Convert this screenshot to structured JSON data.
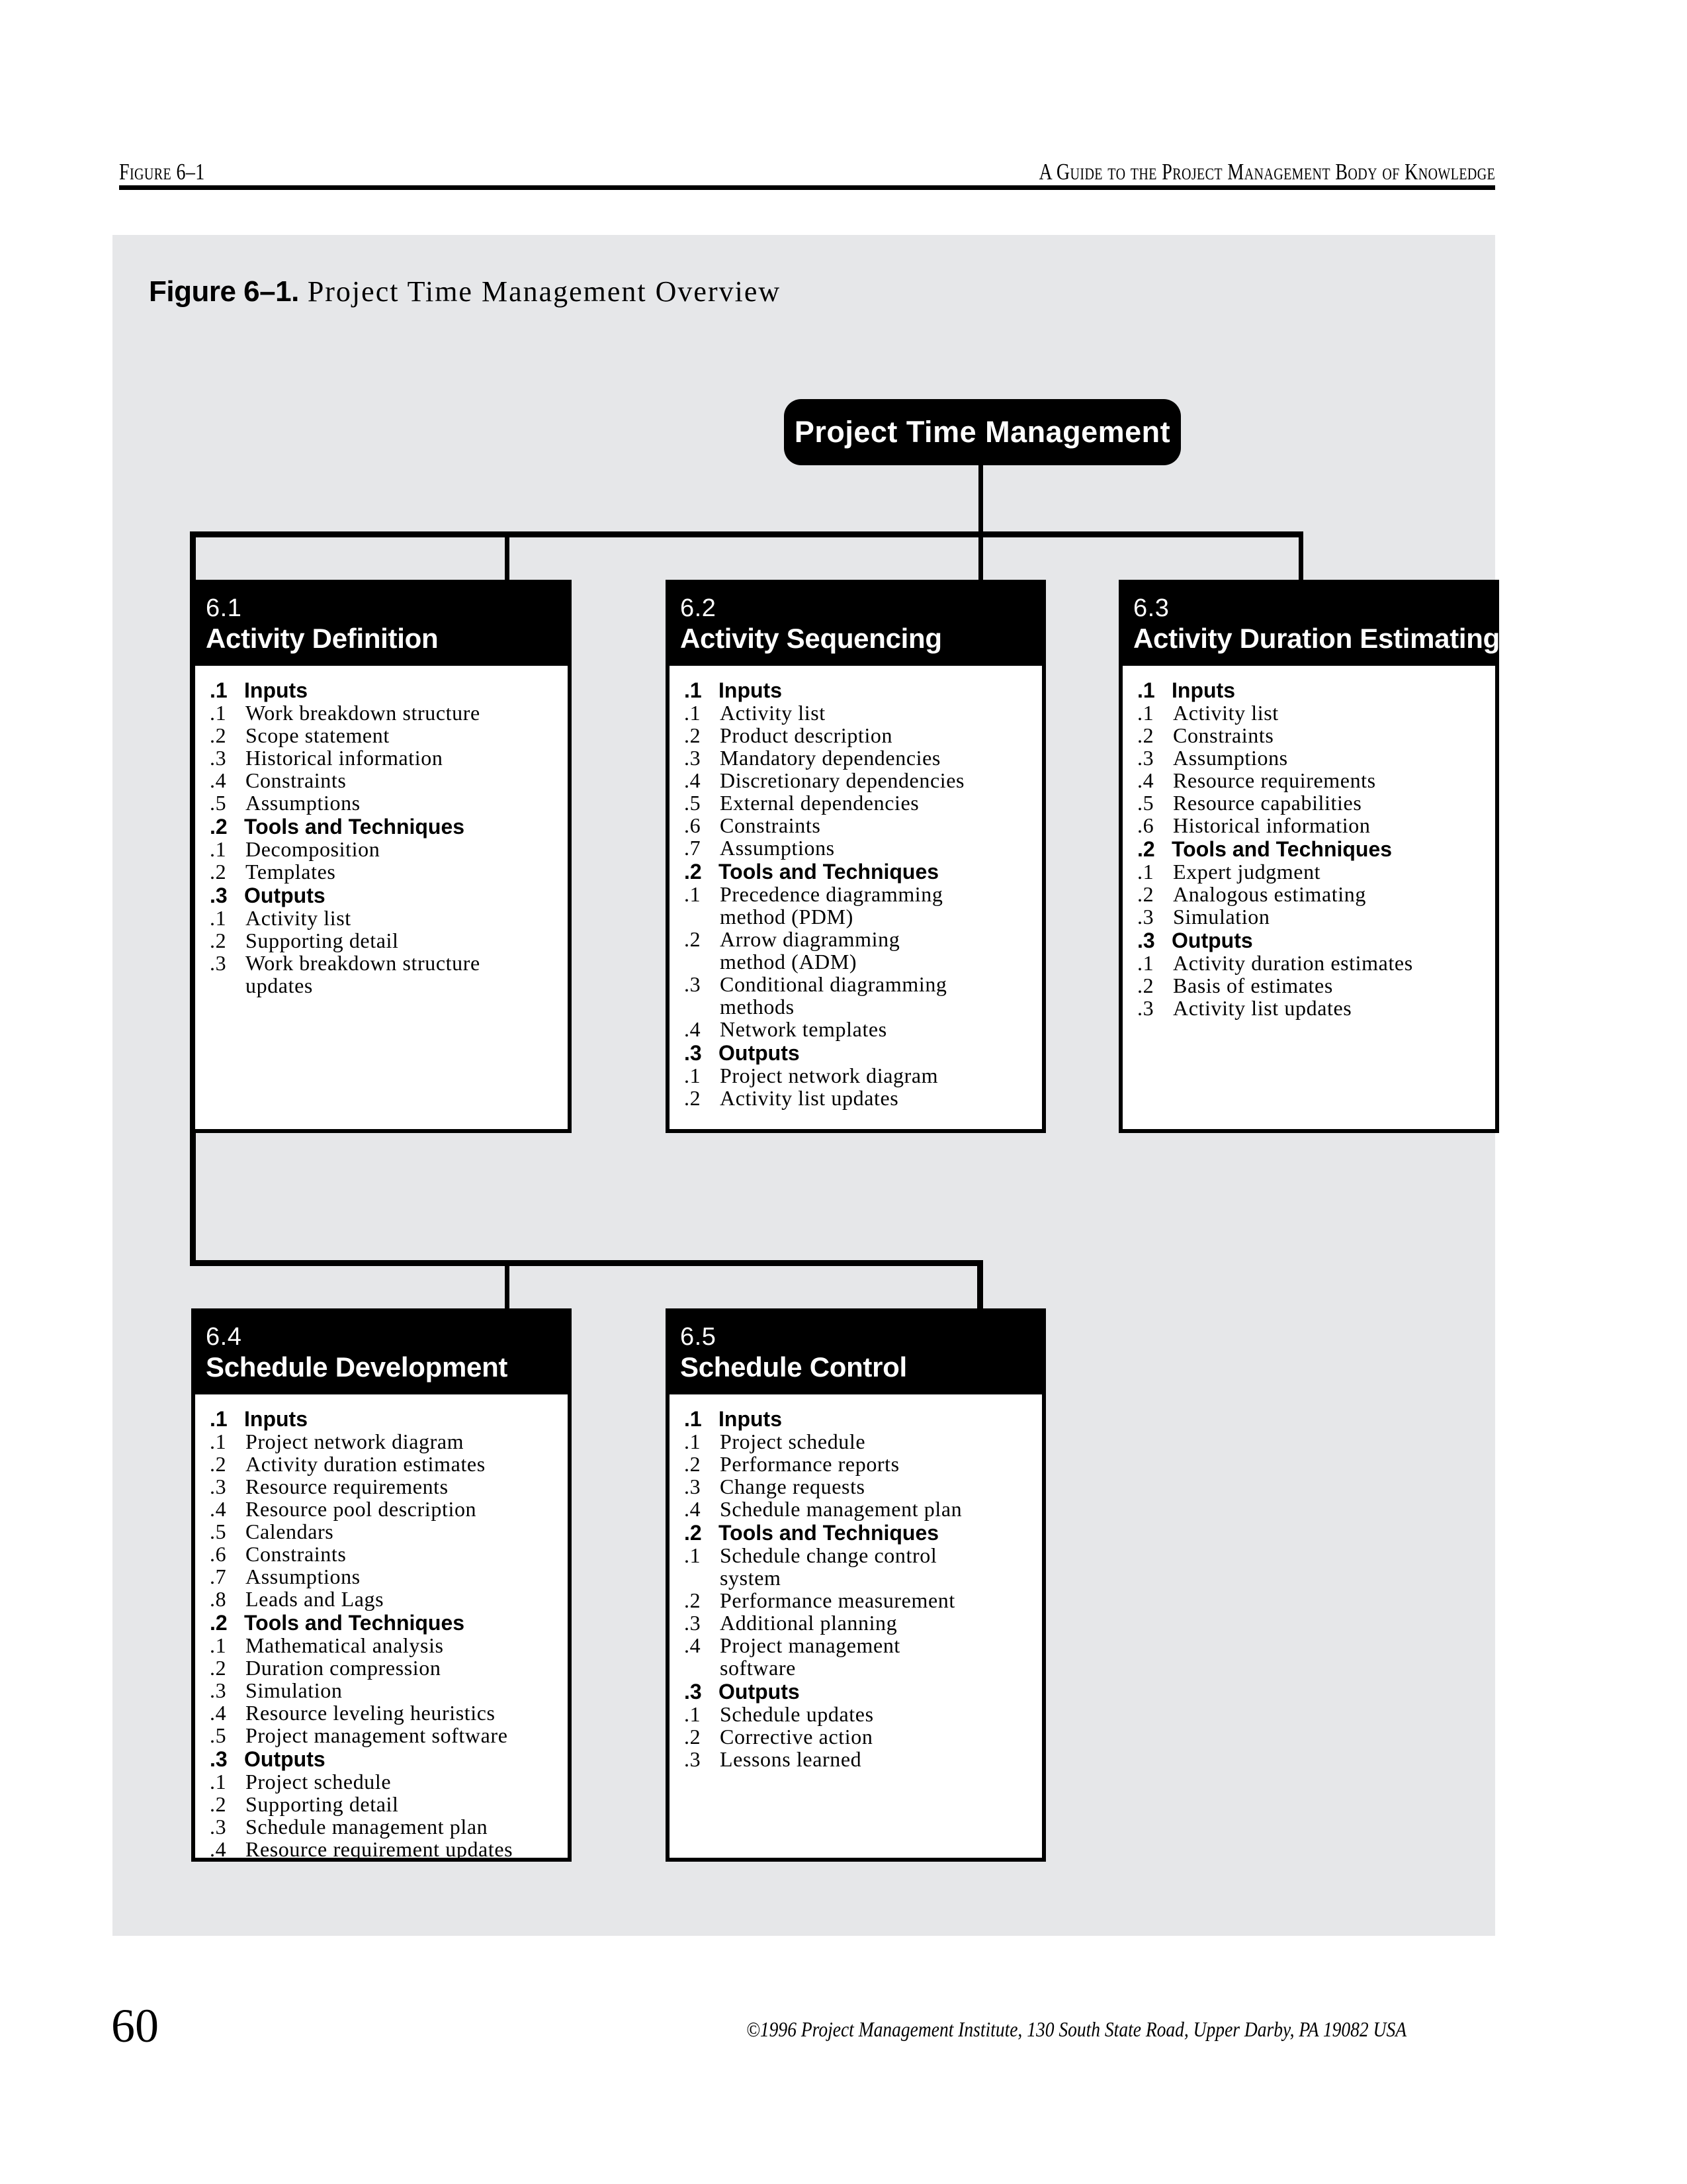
{
  "header": {
    "left": "Figure 6–1",
    "right": "A Guide to the Project Management Body of Knowledge"
  },
  "figure": {
    "caption_bold": "Figure 6–1.",
    "caption_rest": " Project Time Management Overview",
    "root_node": "Project Time Management",
    "panel_color": "#e6e7e9",
    "node_color": "#000000",
    "node_text_color": "#ffffff"
  },
  "diagram_data": {
    "type": "hierarchy",
    "root": "Project Time Management",
    "children": [
      {
        "number": "6.1",
        "title": "Activity Definition",
        "sections": [
          {
            "number": ".1",
            "label": "Inputs",
            "items": [
              {
                "num": ".1",
                "lines": [
                  "Work breakdown structure"
                ]
              },
              {
                "num": ".2",
                "lines": [
                  "Scope statement"
                ]
              },
              {
                "num": ".3",
                "lines": [
                  "Historical information"
                ]
              },
              {
                "num": ".4",
                "lines": [
                  "Constraints"
                ]
              },
              {
                "num": ".5",
                "lines": [
                  "Assumptions"
                ]
              }
            ]
          },
          {
            "number": ".2",
            "label": "Tools and Techniques",
            "items": [
              {
                "num": ".1",
                "lines": [
                  "Decomposition"
                ]
              },
              {
                "num": ".2",
                "lines": [
                  "Templates"
                ]
              }
            ]
          },
          {
            "number": ".3",
            "label": "Outputs",
            "items": [
              {
                "num": ".1",
                "lines": [
                  "Activity list"
                ]
              },
              {
                "num": ".2",
                "lines": [
                  "Supporting detail"
                ]
              },
              {
                "num": ".3",
                "lines": [
                  "Work breakdown structure",
                  "updates"
                ]
              }
            ]
          }
        ]
      },
      {
        "number": "6.2",
        "title": "Activity Sequencing",
        "sections": [
          {
            "number": ".1",
            "label": "Inputs",
            "items": [
              {
                "num": ".1",
                "lines": [
                  "Activity list"
                ]
              },
              {
                "num": ".2",
                "lines": [
                  "Product description"
                ]
              },
              {
                "num": ".3",
                "lines": [
                  "Mandatory dependencies"
                ]
              },
              {
                "num": ".4",
                "lines": [
                  "Discretionary dependencies"
                ]
              },
              {
                "num": ".5",
                "lines": [
                  "External dependencies"
                ]
              },
              {
                "num": ".6",
                "lines": [
                  "Constraints"
                ]
              },
              {
                "num": ".7",
                "lines": [
                  "Assumptions"
                ]
              }
            ]
          },
          {
            "number": ".2",
            "label": "Tools and Techniques",
            "items": [
              {
                "num": ".1",
                "lines": [
                  "Precedence diagramming",
                  "method (PDM)"
                ]
              },
              {
                "num": ".2",
                "lines": [
                  "Arrow diagramming",
                  "method (ADM)"
                ]
              },
              {
                "num": ".3",
                "lines": [
                  "Conditional diagramming",
                  "methods"
                ]
              },
              {
                "num": ".4",
                "lines": [
                  "Network templates"
                ]
              }
            ]
          },
          {
            "number": ".3",
            "label": "Outputs",
            "items": [
              {
                "num": ".1",
                "lines": [
                  "Project network diagram"
                ]
              },
              {
                "num": ".2",
                "lines": [
                  "Activity list updates"
                ]
              }
            ]
          }
        ]
      },
      {
        "number": "6.3",
        "title": "Activity Duration Estimating",
        "sections": [
          {
            "number": ".1",
            "label": "Inputs",
            "items": [
              {
                "num": ".1",
                "lines": [
                  "Activity list"
                ]
              },
              {
                "num": ".2",
                "lines": [
                  "Constraints"
                ]
              },
              {
                "num": ".3",
                "lines": [
                  "Assumptions"
                ]
              },
              {
                "num": ".4",
                "lines": [
                  "Resource requirements"
                ]
              },
              {
                "num": ".5",
                "lines": [
                  "Resource capabilities"
                ]
              },
              {
                "num": ".6",
                "lines": [
                  "Historical information"
                ]
              }
            ]
          },
          {
            "number": ".2",
            "label": "Tools and Techniques",
            "items": [
              {
                "num": ".1",
                "lines": [
                  "Expert judgment"
                ]
              },
              {
                "num": ".2",
                "lines": [
                  "Analogous estimating"
                ]
              },
              {
                "num": ".3",
                "lines": [
                  "Simulation"
                ]
              }
            ]
          },
          {
            "number": ".3",
            "label": "Outputs",
            "items": [
              {
                "num": ".1",
                "lines": [
                  "Activity duration estimates"
                ]
              },
              {
                "num": ".2",
                "lines": [
                  "Basis of estimates"
                ]
              },
              {
                "num": ".3",
                "lines": [
                  "Activity list updates"
                ]
              }
            ]
          }
        ]
      },
      {
        "number": "6.4",
        "title": "Schedule Development",
        "sections": [
          {
            "number": ".1",
            "label": "Inputs",
            "items": [
              {
                "num": ".1",
                "lines": [
                  "Project network diagram"
                ]
              },
              {
                "num": ".2",
                "lines": [
                  "Activity duration estimates"
                ]
              },
              {
                "num": ".3",
                "lines": [
                  "Resource requirements"
                ]
              },
              {
                "num": ".4",
                "lines": [
                  "Resource pool description"
                ]
              },
              {
                "num": ".5",
                "lines": [
                  "Calendars"
                ]
              },
              {
                "num": ".6",
                "lines": [
                  "Constraints"
                ]
              },
              {
                "num": ".7",
                "lines": [
                  "Assumptions"
                ]
              },
              {
                "num": ".8",
                "lines": [
                  "Leads and Lags"
                ]
              }
            ]
          },
          {
            "number": ".2",
            "label": "Tools and Techniques",
            "items": [
              {
                "num": ".1",
                "lines": [
                  "Mathematical analysis"
                ]
              },
              {
                "num": ".2",
                "lines": [
                  "Duration compression"
                ]
              },
              {
                "num": ".3",
                "lines": [
                  "Simulation"
                ]
              },
              {
                "num": ".4",
                "lines": [
                  "Resource leveling heuristics"
                ]
              },
              {
                "num": ".5",
                "lines": [
                  "Project management software"
                ]
              }
            ]
          },
          {
            "number": ".3",
            "label": "Outputs",
            "items": [
              {
                "num": ".1",
                "lines": [
                  "Project schedule"
                ]
              },
              {
                "num": ".2",
                "lines": [
                  "Supporting detail"
                ]
              },
              {
                "num": ".3",
                "lines": [
                  "Schedule management plan"
                ]
              },
              {
                "num": ".4",
                "lines": [
                  "Resource requirement updates"
                ]
              }
            ]
          }
        ]
      },
      {
        "number": "6.5",
        "title": "Schedule Control",
        "sections": [
          {
            "number": ".1",
            "label": "Inputs",
            "items": [
              {
                "num": ".1",
                "lines": [
                  "Project schedule"
                ]
              },
              {
                "num": ".2",
                "lines": [
                  "Performance reports"
                ]
              },
              {
                "num": ".3",
                "lines": [
                  "Change requests"
                ]
              },
              {
                "num": ".4",
                "lines": [
                  "Schedule management plan"
                ]
              }
            ]
          },
          {
            "number": ".2",
            "label": "Tools and Techniques",
            "items": [
              {
                "num": ".1",
                "lines": [
                  "Schedule change control",
                  "system"
                ]
              },
              {
                "num": ".2",
                "lines": [
                  "Performance measurement"
                ]
              },
              {
                "num": ".3",
                "lines": [
                  "Additional planning"
                ]
              },
              {
                "num": ".4",
                "lines": [
                  "Project management",
                  "software"
                ]
              }
            ]
          },
          {
            "number": ".3",
            "label": "Outputs",
            "items": [
              {
                "num": ".1",
                "lines": [
                  "Schedule updates"
                ]
              },
              {
                "num": ".2",
                "lines": [
                  "Corrective action"
                ]
              },
              {
                "num": ".3",
                "lines": [
                  "Lessons learned"
                ]
              }
            ]
          }
        ]
      }
    ]
  },
  "footer": {
    "page_number": "60",
    "copyright": "©1996 Project Management Institute, 130 South State Road, Upper Darby, PA 19082 USA"
  }
}
